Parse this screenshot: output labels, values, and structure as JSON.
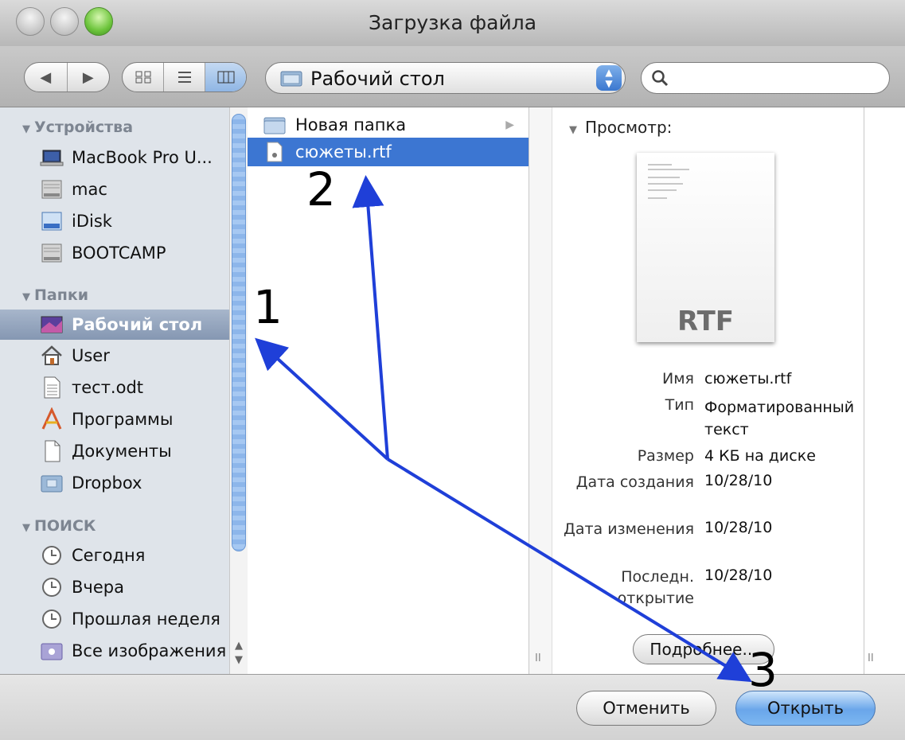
{
  "window": {
    "title": "Загрузка файла"
  },
  "toolbar": {
    "location": "Рабочий стол",
    "search_placeholder": ""
  },
  "sidebar": {
    "sections": [
      {
        "label": "Устройства",
        "items": [
          {
            "label": "MacBook Pro U...",
            "icon": "laptop-icon"
          },
          {
            "label": "mac",
            "icon": "hard-drive-icon"
          },
          {
            "label": "iDisk",
            "icon": "idisk-icon"
          },
          {
            "label": "BOOTCAMP",
            "icon": "hard-drive-icon"
          }
        ]
      },
      {
        "label": "Папки",
        "items": [
          {
            "label": "Рабочий стол",
            "icon": "desktop-icon",
            "selected": true
          },
          {
            "label": "User",
            "icon": "home-icon"
          },
          {
            "label": "тест.odt",
            "icon": "document-icon"
          },
          {
            "label": "Программы",
            "icon": "applications-icon"
          },
          {
            "label": "Документы",
            "icon": "documents-icon"
          },
          {
            "label": "Dropbox",
            "icon": "folder-icon"
          }
        ]
      },
      {
        "label": "ПОИСК",
        "items": [
          {
            "label": "Сегодня",
            "icon": "clock-icon"
          },
          {
            "label": "Вчера",
            "icon": "clock-icon"
          },
          {
            "label": "Прошлая неделя",
            "icon": "clock-icon"
          },
          {
            "label": "Все изображения",
            "icon": "smart-folder-icon"
          }
        ]
      }
    ]
  },
  "files": [
    {
      "name": "Новая папка",
      "type": "folder"
    },
    {
      "name": "сюжеты.rtf",
      "type": "rtf",
      "selected": true
    }
  ],
  "preview": {
    "header": "Просмотр:",
    "doc_type": "RTF",
    "fields": [
      {
        "key": "Имя",
        "value": "сюжеты.rtf"
      },
      {
        "key": "Тип",
        "value": "Форматированный текст"
      },
      {
        "key": "Размер",
        "value": "4 КБ на диске"
      },
      {
        "key": "Дата создания",
        "value": "10/28/10"
      },
      {
        "key": "Дата изменения",
        "value": "10/28/10"
      },
      {
        "key": "Последн. открытие",
        "value": "10/28/10"
      }
    ],
    "more_button": "Подробнее..."
  },
  "buttons": {
    "cancel": "Отменить",
    "open": "Открыть"
  },
  "annotations": {
    "step1": "1",
    "step2": "2",
    "step3": "3",
    "arrow_color": "#1f3fd8"
  }
}
